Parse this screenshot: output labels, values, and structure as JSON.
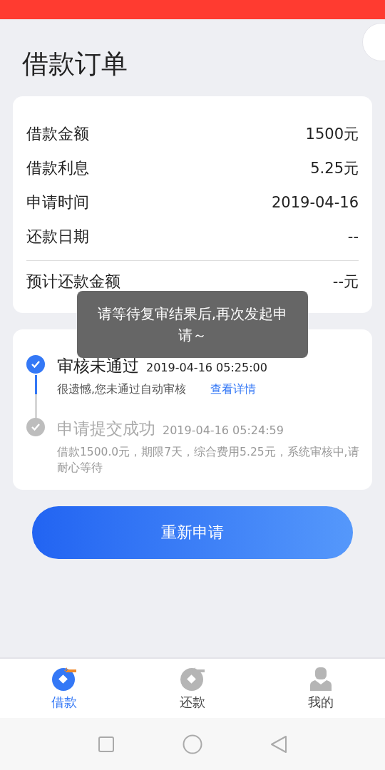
{
  "title": "借款订单",
  "summary": {
    "rows": [
      {
        "label": "借款金额",
        "value": "1500元"
      },
      {
        "label": "借款利息",
        "value": "5.25元"
      },
      {
        "label": "申请时间",
        "value": "2019-04-16"
      },
      {
        "label": "还款日期",
        "value": "--"
      }
    ],
    "total": {
      "label": "预计还款金额",
      "value": "--元"
    }
  },
  "timeline": [
    {
      "title": "审核未通过",
      "time": "2019-04-16 05:25:00",
      "desc": "很遗憾,您未通过自动审核",
      "link": "查看详情",
      "active": true
    },
    {
      "title": "申请提交成功",
      "time": "2019-04-16 05:24:59",
      "desc": "借款1500.0元，期限7天，综合费用5.25元，系统审核中,请耐心等待",
      "active": false
    }
  ],
  "button": "重新申请",
  "toast": "请等待复审结果后,再次发起申请～",
  "tabs": [
    {
      "label": "借款",
      "kind": "borrow",
      "selected": true
    },
    {
      "label": "还款",
      "kind": "repay",
      "selected": false
    },
    {
      "label": "我的",
      "kind": "profile",
      "selected": false
    }
  ]
}
